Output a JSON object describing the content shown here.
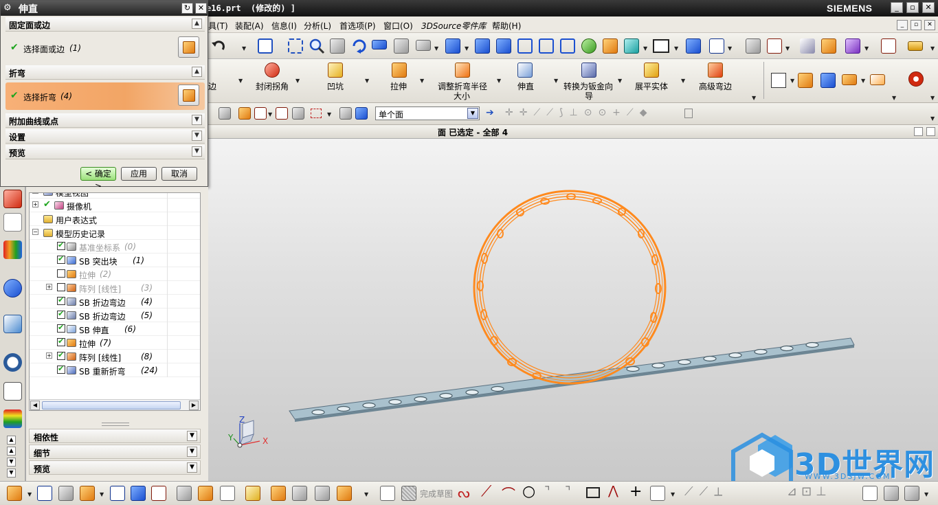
{
  "window": {
    "file_title": "e16.prt  (修改的) ]",
    "brand": "SIEMENS",
    "min": "_",
    "restore": "▫",
    "close": "✕"
  },
  "menu": [
    "具(T)",
    "装配(A)",
    "信息(I)",
    "分析(L)",
    "首选项(P)",
    "窗口(O)",
    "3DSource零件库",
    "帮助(H)"
  ],
  "sheetmetal_toolbar": {
    "buttons": [
      "边",
      "封闭拐角",
      "凹坑",
      "拉伸",
      "调整折弯半径",
      "伸直",
      "转换为钣金向",
      "展平实体",
      "高级弯边"
    ],
    "button2_line2": [
      "",
      "",
      "",
      "",
      "大小",
      "",
      "导",
      "",
      ""
    ]
  },
  "selection_bar": {
    "filter_value": "单个面"
  },
  "status_strip": {
    "text": "面 已选定 - 全部 4"
  },
  "dialog": {
    "title": "伸直",
    "sections": {
      "fixed_face": "固定面或边",
      "select_face_label": "选择面或边",
      "select_face_count": "(1)",
      "bend": "折弯",
      "select_bend_label": "选择折弯",
      "select_bend_count": "(4)",
      "additional": "附加曲线或点",
      "settings": "设置",
      "preview": "预览"
    },
    "ok": "< 确定 >",
    "apply": "应用",
    "cancel": "取消"
  },
  "navigator": {
    "rows": [
      {
        "label": "模型视图",
        "count": "",
        "indent": 1,
        "checkbox": "none",
        "icon": "view",
        "dim": false,
        "expand": "+"
      },
      {
        "label": "摄像机",
        "count": "",
        "indent": 1,
        "checkbox": "check",
        "icon": "camera",
        "dim": false,
        "expand": "+"
      },
      {
        "label": "用户表达式",
        "count": "",
        "indent": 1,
        "checkbox": "none",
        "icon": "folder",
        "dim": false,
        "expand": ""
      },
      {
        "label": "模型历史记录",
        "count": "",
        "indent": 1,
        "checkbox": "none",
        "icon": "folder",
        "dim": false,
        "expand": "-"
      },
      {
        "label": "基准坐标系",
        "count": "(0)",
        "indent": 2,
        "checkbox": "on",
        "icon": "datum",
        "dim": true,
        "expand": ""
      },
      {
        "label": "SB 突出块",
        "count": "(1)",
        "indent": 2,
        "checkbox": "on",
        "icon": "tab",
        "dim": false,
        "expand": ""
      },
      {
        "label": "拉伸",
        "count": "(2)",
        "indent": 2,
        "checkbox": "off",
        "icon": "extrude",
        "dim": true,
        "expand": ""
      },
      {
        "label": "阵列 [线性]",
        "count": "(3)",
        "indent": 2,
        "checkbox": "off",
        "icon": "pattern",
        "dim": true,
        "expand": "+"
      },
      {
        "label": "SB 折边弯边",
        "count": "(4)",
        "indent": 2,
        "checkbox": "on",
        "icon": "hem",
        "dim": false,
        "expand": ""
      },
      {
        "label": "SB 折边弯边",
        "count": "(5)",
        "indent": 2,
        "checkbox": "on",
        "icon": "hem",
        "dim": false,
        "expand": ""
      },
      {
        "label": "SB 伸直",
        "count": "(6)",
        "indent": 2,
        "checkbox": "on",
        "icon": "unbend",
        "dim": false,
        "expand": ""
      },
      {
        "label": "拉伸",
        "count": "(7)",
        "indent": 2,
        "checkbox": "on",
        "icon": "extrude",
        "dim": false,
        "expand": ""
      },
      {
        "label": "阵列 [线性]",
        "count": "(8)",
        "indent": 2,
        "checkbox": "on",
        "icon": "pattern",
        "dim": false,
        "expand": "+"
      },
      {
        "label": "SB 重新折弯",
        "count": "(24)",
        "indent": 2,
        "checkbox": "on",
        "icon": "rebend",
        "dim": false,
        "expand": ""
      }
    ],
    "sections": [
      "相依性",
      "细节",
      "预览"
    ]
  },
  "bottom_toolbar": {
    "sketch_label": "完成草图"
  },
  "axes": {
    "z": "Z",
    "y": "Y",
    "x": "X"
  },
  "watermark": {
    "title": "3D世界网",
    "url": "WWW.3DSJW.COM"
  },
  "colors": {
    "accent_orange": "#ff8a1e",
    "selected_row": "#f2a565",
    "check_green": "#1ea51e",
    "strip_blue": "#9fb8c6",
    "watermark_blue": "#3fa0e8"
  }
}
